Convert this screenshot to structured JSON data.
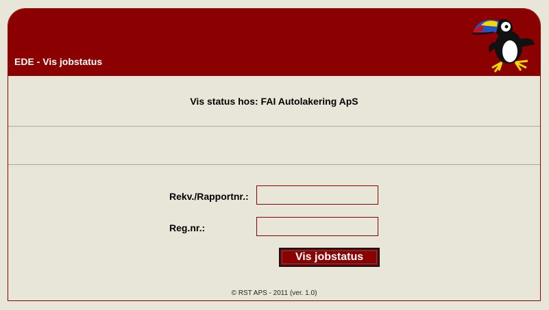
{
  "header": {
    "title": "EDE - Vis jobstatus",
    "logo_icon": "toucan-icon"
  },
  "status": {
    "text": "Vis status hos: FAI Autolakering ApS"
  },
  "form": {
    "rekv_label": "Rekv./Rapportnr.:",
    "rekv_value": "",
    "regnr_label": "Reg.nr.:",
    "regnr_value": "",
    "submit_label": "Vis jobstatus"
  },
  "footer": {
    "text": "© RST APS - 2011 (ver. 1.0)"
  },
  "colors": {
    "brand": "#8b0000",
    "background": "#e8e6d8"
  }
}
